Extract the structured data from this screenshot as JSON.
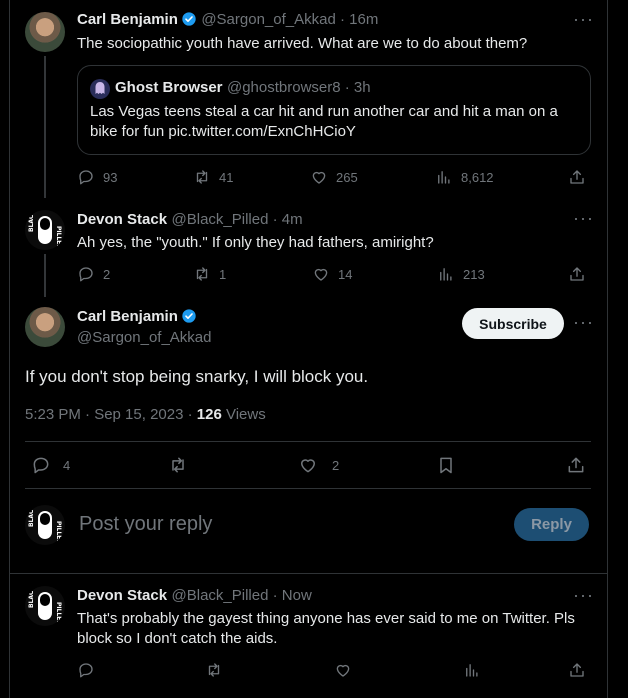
{
  "colors": {
    "background": "#000000",
    "text": "#e7e9ea",
    "muted": "#71767b",
    "border": "#2f3336",
    "verified_blue": "#1d9bf0",
    "reply_button": "#1d4e73"
  },
  "tweet1": {
    "name": "Carl Benjamin",
    "handle": "@Sargon_of_Akkad · 16m",
    "text": "The sociopathic youth have arrived. What are we to do about them?",
    "quote": {
      "name": "Ghost Browser",
      "handle": "@ghostbrowser8 · 3h",
      "text_line1": "Las Vegas teens steal a car hit and run another car and hit a man on a",
      "text_line2": "bike for fun pic.twitter.com/ExnChHCioY"
    },
    "replies": "93",
    "retweets": "41",
    "likes": "265",
    "views": "8,612"
  },
  "tweet2": {
    "name": "Devon Stack",
    "handle": "@Black_Pilled · 4m",
    "text": "Ah yes, the \"youth.\" If only they had fathers, amiright?",
    "replies": "2",
    "retweets": "1",
    "likes": "14",
    "views": "213"
  },
  "main": {
    "name": "Carl Benjamin",
    "handle": "@Sargon_of_Akkad",
    "subscribe_label": "Subscribe",
    "text": "If you don't stop being snarky, I will block you.",
    "meta_prefix": "5:23 PM · Sep 15, 2023 · ",
    "view_count": "126",
    "views_label": " Views",
    "replies": "4",
    "likes": "2"
  },
  "reply_box": {
    "placeholder": "Post your reply",
    "button_label": "Reply"
  },
  "tweet3": {
    "name": "Devon Stack",
    "handle": "@Black_Pilled · Now",
    "text_line1": "That's probably the gayest thing anyone has ever said to me on Twitter. Pls",
    "text_line2": "block so I don't catch the aids."
  }
}
